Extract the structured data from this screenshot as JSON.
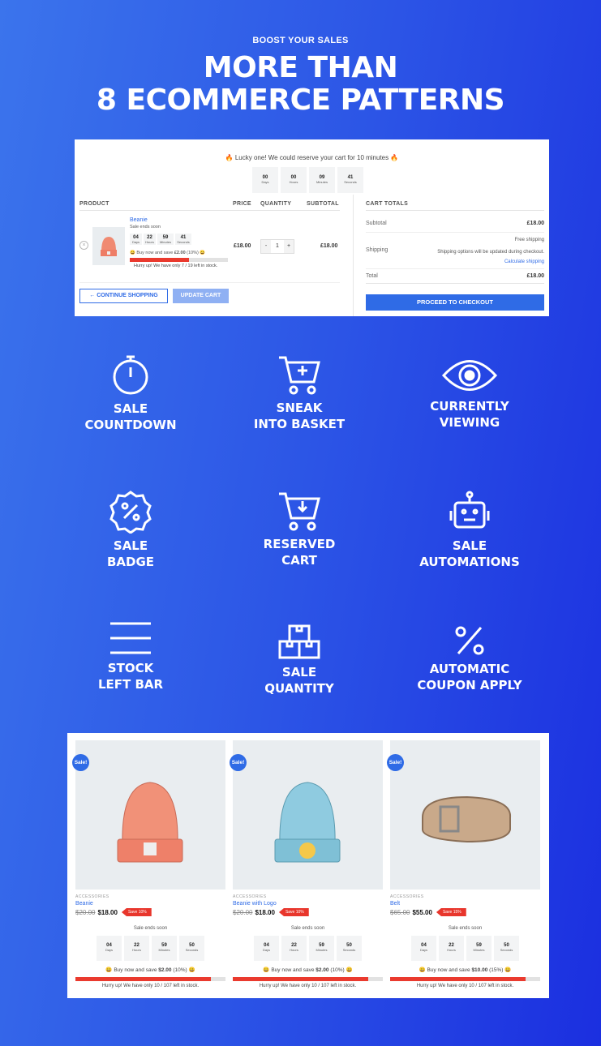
{
  "header": {
    "kicker": "BOOST YOUR SALES",
    "title_line1": "MORE THAN",
    "title_line2": "8 ECOMMERCE PATTERNS"
  },
  "cart": {
    "notice": "🔥 Lucky one! We could reserve your cart for 10 minutes 🔥",
    "reserve_countdown": [
      {
        "v": "00",
        "u": "Days"
      },
      {
        "v": "00",
        "u": "Hours"
      },
      {
        "v": "09",
        "u": "Minutes"
      },
      {
        "v": "41",
        "u": "Seconds"
      }
    ],
    "columns": {
      "product": "PRODUCT",
      "price": "PRICE",
      "quantity": "QUANTITY",
      "subtotal": "SUBTOTAL"
    },
    "item": {
      "name": "Beanie",
      "sale_note": "Sale ends soon",
      "countdown": [
        {
          "v": "04",
          "u": "Days"
        },
        {
          "v": "22",
          "u": "Hours"
        },
        {
          "v": "59",
          "u": "Minutes"
        },
        {
          "v": "41",
          "u": "Seconds"
        }
      ],
      "save_pre": "😀 Buy now and save ",
      "save_amt": "£2.00",
      "save_post": " (10%) 😀",
      "stock_text": "Hurry up! We have only 7 / 19 left in stock.",
      "stock_bar_percent": 60,
      "price": "£18.00",
      "qty": "1",
      "minus": "-",
      "plus": "+",
      "subtotal": "£18.00"
    },
    "continue_label": "← CONTINUE SHOPPING",
    "update_label": "UPDATE CART",
    "totals": {
      "heading": "CART TOTALS",
      "subtotal_label": "Subtotal",
      "subtotal": "£18.00",
      "shipping_label": "Shipping",
      "shipping_value": "Free shipping",
      "shipping_note": "Shipping options will be updated during checkout.",
      "calc_link": "Calculate shipping",
      "total_label": "Total",
      "total": "£18.00",
      "checkout_label": "PROCEED TO CHECKOUT"
    }
  },
  "features": [
    {
      "icon": "stopwatch-icon",
      "l1": "SALE",
      "l2": "COUNTDOWN"
    },
    {
      "icon": "cart-plus-icon",
      "l1": "SNEAK",
      "l2": "INTO BASKET"
    },
    {
      "icon": "eye-icon",
      "l1": "CURRENTLY",
      "l2": "VIEWING"
    },
    {
      "icon": "percent-badge-icon",
      "l1": "SALE",
      "l2": "BADGE"
    },
    {
      "icon": "cart-download-icon",
      "l1": "RESERVED",
      "l2": "CART"
    },
    {
      "icon": "robot-icon",
      "l1": "SALE",
      "l2": "AUTOMATIONS"
    },
    {
      "icon": "bars-icon",
      "l1": "STOCK",
      "l2": "LEFT BAR"
    },
    {
      "icon": "boxes-icon",
      "l1": "SALE",
      "l2": "QUANTITY"
    },
    {
      "icon": "percent-icon",
      "l1": "AUTOMATIC",
      "l2": "COUPON APPLY"
    }
  ],
  "products": [
    {
      "badge": "Sale!",
      "category": "ACCESSORIES",
      "name": "Beanie",
      "old": "$20.00",
      "new": "$18.00",
      "tag": "Save 10%",
      "sale_note": "Sale ends soon",
      "countdown": [
        {
          "v": "04",
          "u": "Days"
        },
        {
          "v": "22",
          "u": "Hours"
        },
        {
          "v": "59",
          "u": "Minutes"
        },
        {
          "v": "50",
          "u": "Seconds"
        }
      ],
      "save_pre": "😀 Buy now and save ",
      "save_amt": "$2.00",
      "save_post": " (10%) 😀",
      "stock_bar_percent": 90,
      "stock_text": "Hurry up! We have only 10 / 107 left in stock."
    },
    {
      "badge": "Sale!",
      "category": "ACCESSORIES",
      "name": "Beanie with Logo",
      "old": "$20.00",
      "new": "$18.00",
      "tag": "Save 10%",
      "sale_note": "Sale ends soon",
      "countdown": [
        {
          "v": "04",
          "u": "Days"
        },
        {
          "v": "22",
          "u": "Hours"
        },
        {
          "v": "59",
          "u": "Minutes"
        },
        {
          "v": "50",
          "u": "Seconds"
        }
      ],
      "save_pre": "😀 Buy now and save ",
      "save_amt": "$2.00",
      "save_post": " (10%) 😀",
      "stock_bar_percent": 90,
      "stock_text": "Hurry up! We have only 10 / 107 left in stock."
    },
    {
      "badge": "Sale!",
      "category": "ACCESSORIES",
      "name": "Belt",
      "old": "$65.00",
      "new": "$55.00",
      "tag": "Save 15%",
      "sale_note": "Sale ends soon",
      "countdown": [
        {
          "v": "04",
          "u": "Days"
        },
        {
          "v": "22",
          "u": "Hours"
        },
        {
          "v": "59",
          "u": "Minutes"
        },
        {
          "v": "50",
          "u": "Seconds"
        }
      ],
      "save_pre": "😀 Buy now and save ",
      "save_amt": "$10.00",
      "save_post": " (15%) 😀",
      "stock_bar_percent": 90,
      "stock_text": "Hurry up! We have only 10 / 107 left in stock."
    }
  ]
}
